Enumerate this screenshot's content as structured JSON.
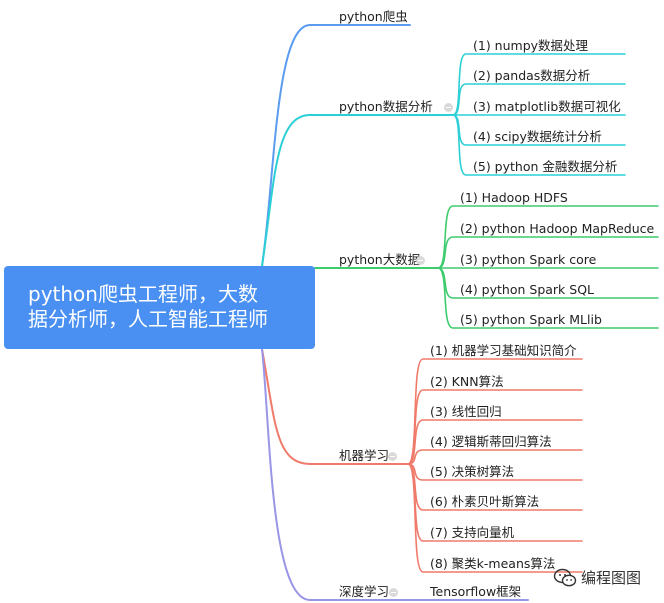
{
  "root": {
    "title_line1": "python爬虫工程师，大数",
    "title_line2": "据分析师，人工智能工程师"
  },
  "branches": [
    {
      "label": "python爬虫",
      "color": "#5b9cf0",
      "collapsible": false,
      "children": []
    },
    {
      "label": "python数据分析",
      "color": "#2ccfd6",
      "collapsible": true,
      "children": [
        "(1) numpy数据处理",
        "(2) pandas数据分析",
        "(3) matplotlib数据可视化",
        "(4) scipy数据统计分析",
        "(5) python 金融数据分析"
      ]
    },
    {
      "label": "python大数据",
      "color": "#3ccc6e",
      "collapsible": true,
      "children": [
        "(1) Hadoop HDFS",
        "(2) python Hadoop MapReduce",
        "(3) python Spark core",
        "(4) python Spark SQL",
        "(5) python Spark MLlib"
      ]
    },
    {
      "label": "机器学习",
      "color": "#f07a6a",
      "collapsible": true,
      "children": [
        "(1) 机器学习基础知识简介",
        "(2) KNN算法",
        "(3) 线性回归",
        "(4) 逻辑斯蒂回归算法",
        "(5) 决策树算法",
        "(6) 朴素贝叶斯算法",
        "(7) 支持向量机",
        "(8) 聚类k-means算法"
      ]
    },
    {
      "label": "深度学习",
      "color": "#9a96e6",
      "collapsible": true,
      "children": [
        "Tensorflow框架"
      ]
    }
  ],
  "watermark": {
    "text": "编程图图"
  }
}
